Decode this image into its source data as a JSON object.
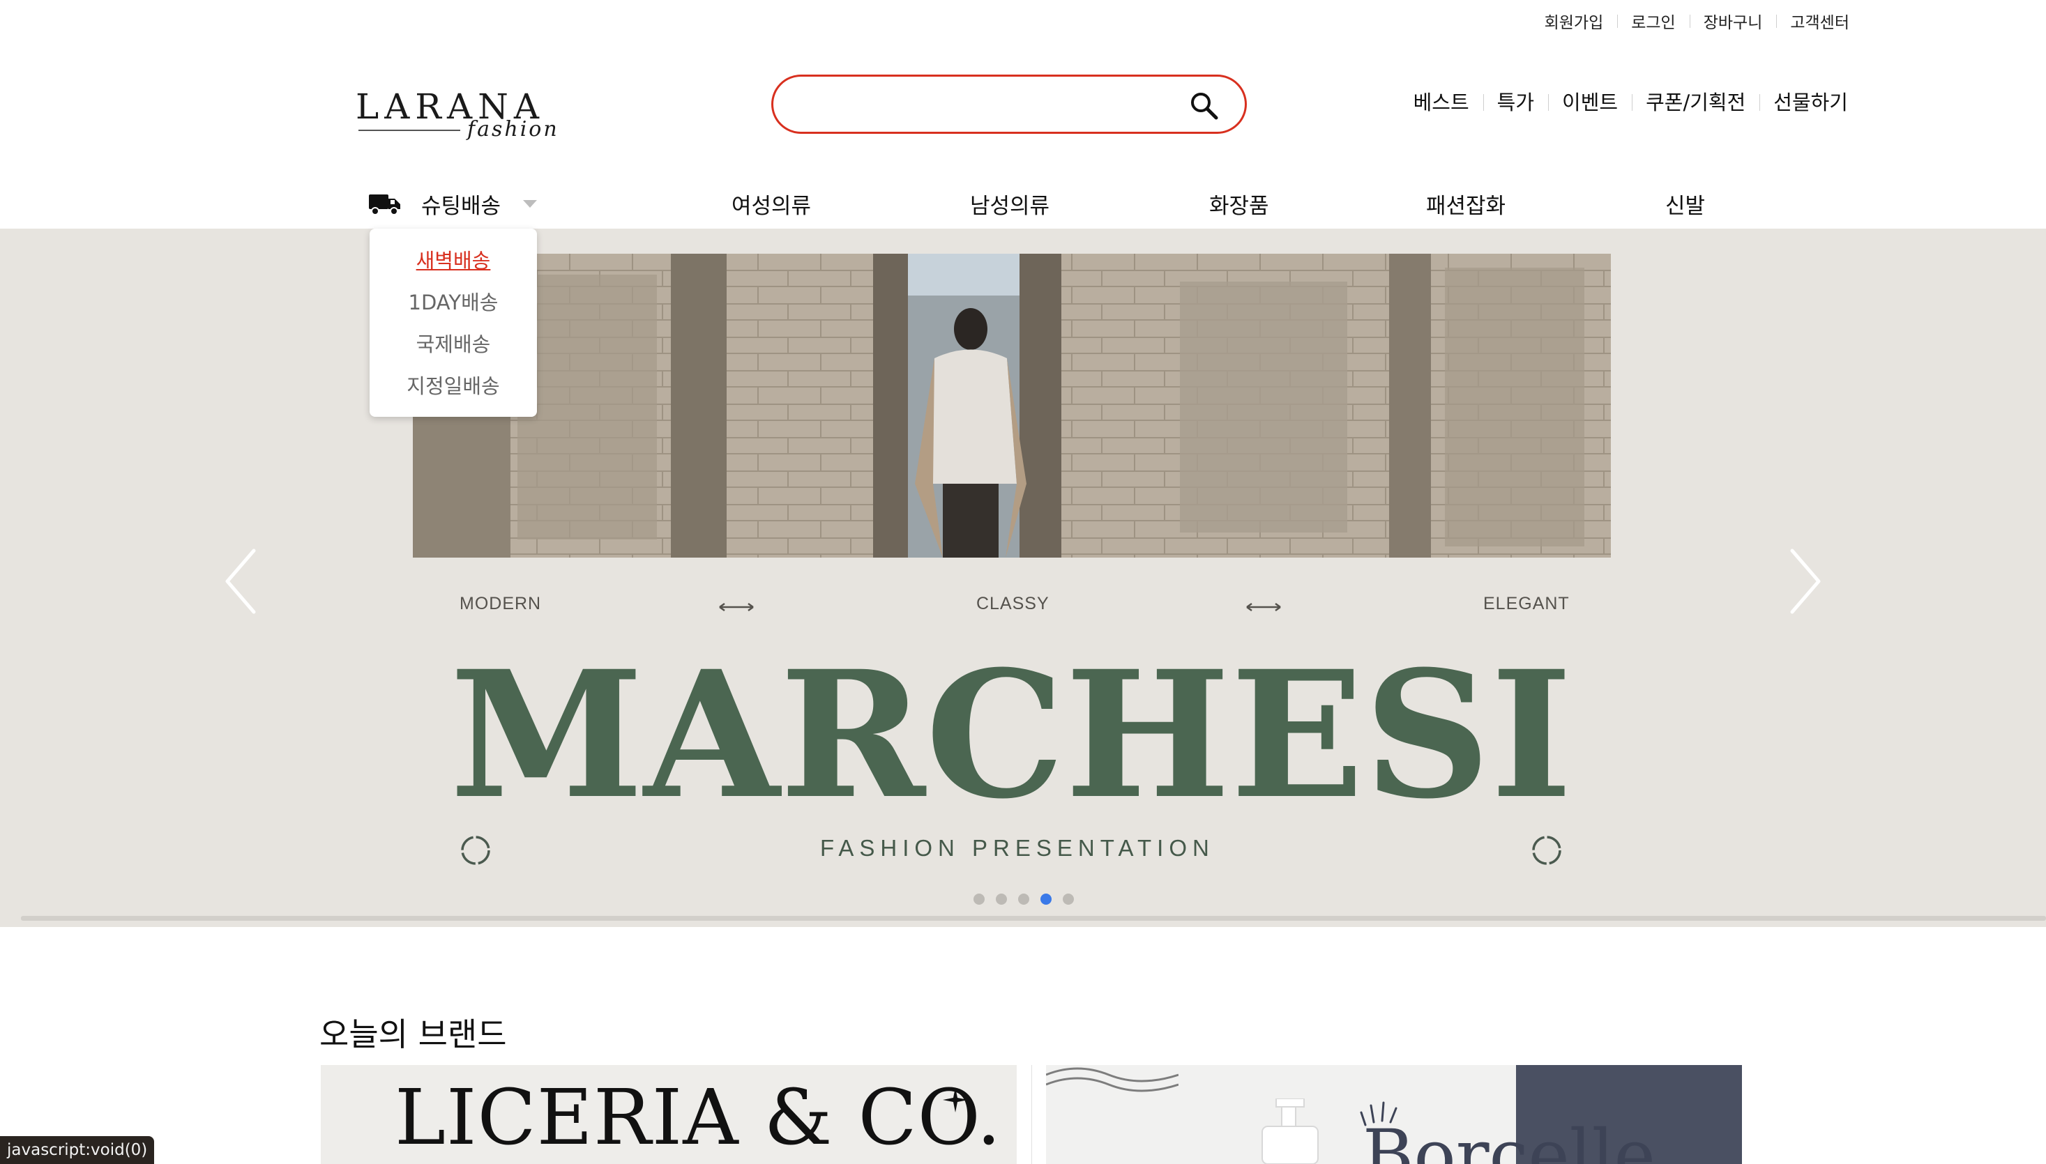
{
  "utility_links": [
    "회원가입",
    "로그인",
    "장바구니",
    "고객센터"
  ],
  "logo": {
    "main": "LARANA",
    "sub": "fashion"
  },
  "search": {
    "placeholder": ""
  },
  "quick_nav": [
    "베스트",
    "특가",
    "이벤트",
    "쿠폰/기획전",
    "선물하기"
  ],
  "shipping_menu": {
    "label": "슈팅배송",
    "items": [
      "새벽배송",
      "1DAY배송",
      "국제배송",
      "지정일배송"
    ],
    "active_item": "새벽배송"
  },
  "categories": [
    "여성의류",
    "남성의류",
    "화장품",
    "패션잡화",
    "신발"
  ],
  "hero": {
    "tag_left": "MODERN",
    "tag_center": "CLASSY",
    "tag_right": "ELEGANT",
    "brand": "MARCHESI",
    "subtitle": "FASHION PRESENTATION",
    "slide_count": 5,
    "active_slide": 4
  },
  "todays_brand": {
    "title": "오늘의 브랜드",
    "cards": [
      {
        "name": "LICERIA & CO."
      },
      {
        "name": "Borcelle"
      }
    ]
  },
  "status_bar": "javascript:void(0)",
  "colors": {
    "accent": "#d8301f",
    "hero_bg": "#e7e4df",
    "brand_green": "#4b6651",
    "dot_active": "#3a79e8",
    "navy_panel": "#4a5062"
  }
}
